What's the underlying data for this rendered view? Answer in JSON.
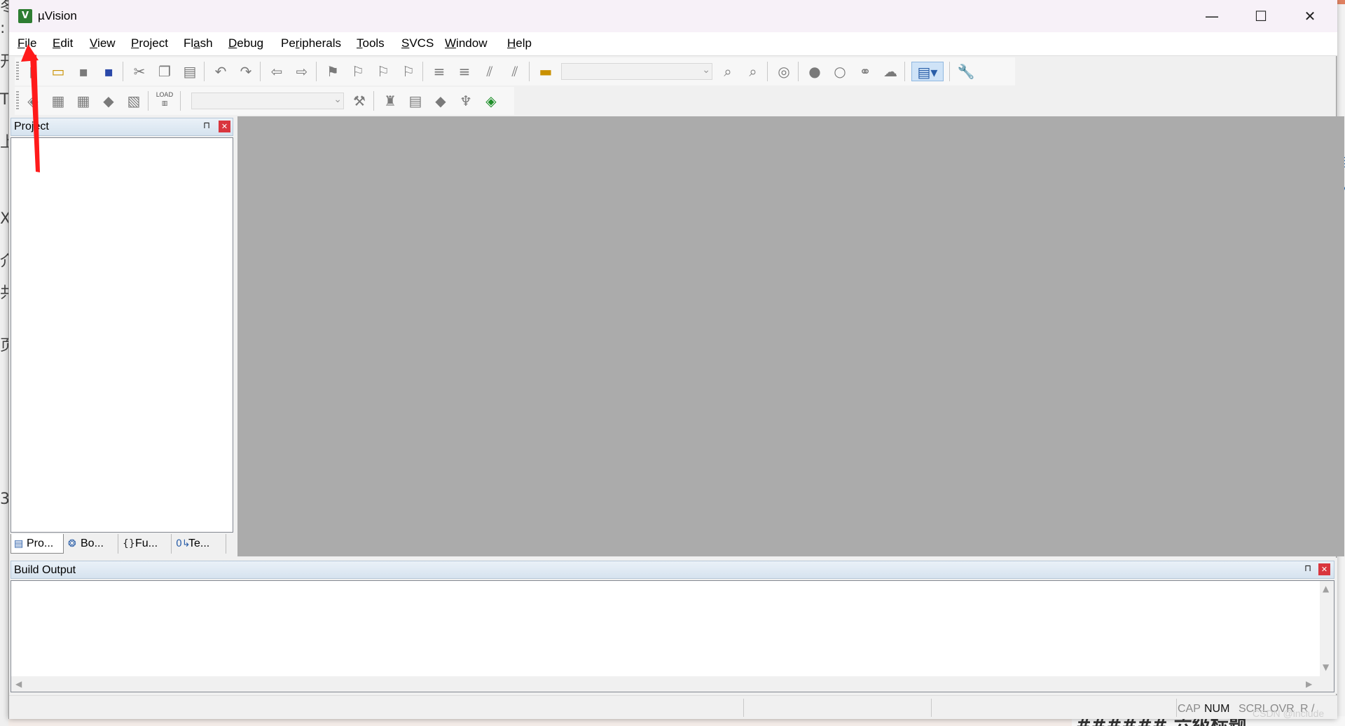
{
  "window": {
    "title": "µVision",
    "app_icon": "uvision-logo-icon",
    "minimize": "—",
    "maximize": "☐",
    "close": "✕"
  },
  "menu": [
    {
      "label": "File",
      "mnemonic": "F"
    },
    {
      "label": "Edit",
      "mnemonic": "E"
    },
    {
      "label": "View",
      "mnemonic": "V"
    },
    {
      "label": "Project",
      "mnemonic": "P"
    },
    {
      "label": "Flash",
      "mnemonic": "a"
    },
    {
      "label": "Debug",
      "mnemonic": "D"
    },
    {
      "label": "Peripherals",
      "mnemonic": "r"
    },
    {
      "label": "Tools",
      "mnemonic": "T"
    },
    {
      "label": "SVCS",
      "mnemonic": "S"
    },
    {
      "label": "Window",
      "mnemonic": "W"
    },
    {
      "label": "Help",
      "mnemonic": "H"
    }
  ],
  "toolbar1": {
    "items": [
      "new-file-icon",
      "open-file-icon",
      "save-icon",
      "save-all-icon",
      "cut-icon",
      "copy-icon",
      "paste-icon",
      "undo-icon",
      "redo-icon",
      "navigate-back-icon",
      "navigate-forward-icon",
      "bookmark-icon",
      "prev-bookmark-icon",
      "next-bookmark-icon",
      "clear-bookmarks-icon",
      "indent-icon",
      "unindent-icon",
      "comment-icon",
      "uncomment-icon",
      "find-in-files-icon",
      "find-icon",
      "incremental-find-icon",
      "debug-session-icon",
      "breakpoint-icon",
      "disable-breakpoint-icon",
      "disable-all-breakpoints-icon",
      "kill-breakpoints-icon",
      "window-layout-icon",
      "configure-icon"
    ]
  },
  "toolbar2": {
    "items": [
      "translate-icon",
      "build-icon",
      "rebuild-icon",
      "batch-build-icon",
      "stop-build-icon",
      "download-icon",
      "target-options-icon",
      "manage-components-icon",
      "select-packs-icon",
      "environment-icon",
      "software-packs-icon",
      "pack-installer-icon"
    ],
    "load_label": "LOAD"
  },
  "project_panel": {
    "title": "Project",
    "pin": "⊓",
    "close": "✕",
    "tabs": [
      {
        "label": "Pro...",
        "icon": "project-tab-icon"
      },
      {
        "label": "Bo...",
        "icon": "books-tab-icon"
      },
      {
        "label": "Fu...",
        "icon": "functions-tab-icon"
      },
      {
        "label": "Te...",
        "icon": "templates-tab-icon"
      }
    ]
  },
  "build_output": {
    "title": "Build Output"
  },
  "status": {
    "indicators": [
      {
        "label": "CAP",
        "on": false
      },
      {
        "label": "NUM",
        "on": true
      },
      {
        "label": "SCRL",
        "on": false
      },
      {
        "label": "OVR",
        "on": false
      },
      {
        "label": "R /",
        "on": false
      }
    ]
  },
  "watermark": "CSDN @include",
  "background": {
    "bottom_heading": "###### 六级标题"
  },
  "annotation": {
    "color": "#ff1a1a"
  }
}
